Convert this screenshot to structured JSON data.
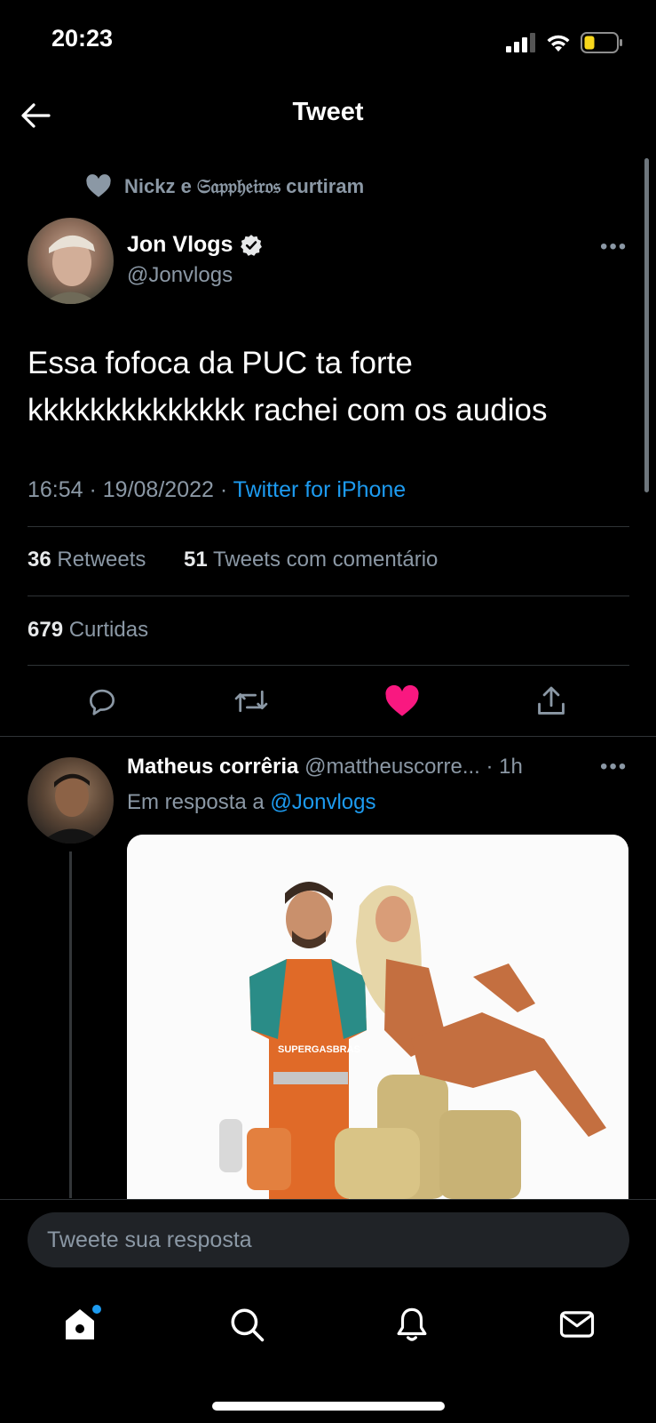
{
  "status_bar": {
    "time": "20:23",
    "battery_color": "#f8d71c"
  },
  "header": {
    "title": "Tweet",
    "back_icon": "arrow-left-icon"
  },
  "social_context": {
    "text": "Nickz e 𝔖𝔞𝔭𝔭𝔥𝔢𝔦𝔯𝔬𝔰 curtiram",
    "icon": "heart-icon"
  },
  "tweet": {
    "author_name": "Jon Vlogs",
    "verified": true,
    "author_handle": "@Jonvlogs",
    "text_line1": "Essa fofoca da PUC ta forte",
    "text_line2": "kkkkkkkkkkkkkk rachei com os audios",
    "time": "16:54 · 19/08/2022 · ",
    "source": "Twitter for iPhone",
    "retweets_count": "36",
    "retweets_label": "Retweets",
    "quotes_count": "51",
    "quotes_label": "Tweets com comentário",
    "likes_count": "679",
    "likes_label": "Curtidas",
    "liked": true
  },
  "actions": [
    "reply-icon",
    "retweet-icon",
    "like-icon",
    "share-icon"
  ],
  "reply": {
    "author_name": "Matheus corrêria",
    "author_handle": "@mattheuscorre...",
    "time": "· 1h",
    "in_reply_prefix": "Em resposta a ",
    "in_reply_handle": "@Jonvlogs",
    "media_logo_text": "SUPERGASBRAS"
  },
  "compose": {
    "placeholder": "Tweete sua resposta"
  },
  "bottom_nav": [
    "home-icon",
    "search-icon",
    "notifications-icon",
    "messages-icon"
  ],
  "colors": {
    "accent": "#1d9bf0",
    "like": "#f91880",
    "background": "#000000",
    "muted": "#8b98a5"
  }
}
